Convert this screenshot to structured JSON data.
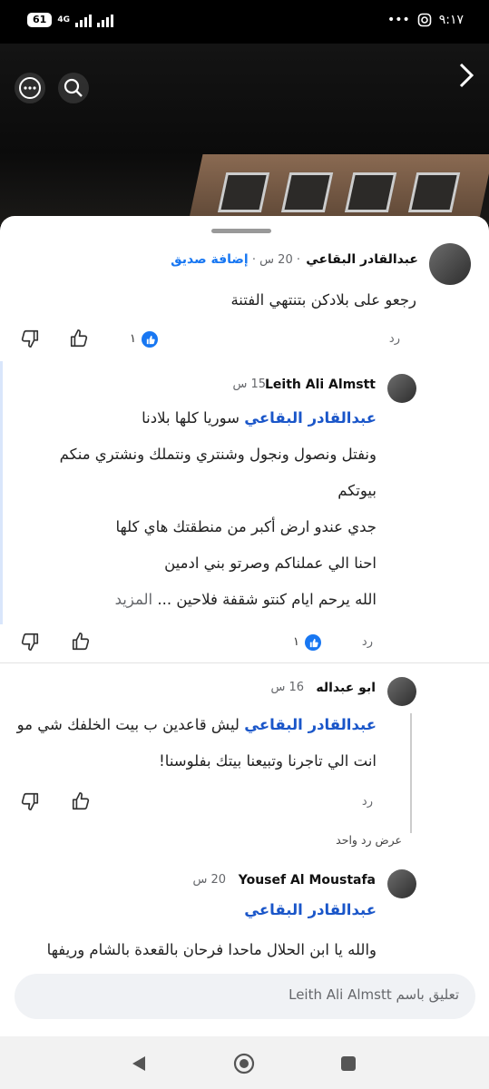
{
  "status": {
    "battery": "61",
    "network": "4G",
    "time": "٩:١٧"
  },
  "post_header": {
    "more_icon": "more-dots-icon",
    "search_icon": "search-icon",
    "next_icon": "chevron-right-icon"
  },
  "comments": [
    {
      "author": "عبدالقادر البقاعي",
      "time": "20 س",
      "separator": "·",
      "add_friend": "إضافة صديق",
      "lines": [
        "رجعو على بلادكن بتنتهي الفتنة"
      ],
      "reply_label": "رد",
      "like_count": "١"
    },
    {
      "author": "Leith Ali Almstt",
      "time": "15 س",
      "mention": "عبدالقادر البقاعي",
      "first_line_rest": "سوريا كلها بلادنا",
      "lines": [
        "ونفتل ونصول ونجول وشنتري ونتملك ونشتري منكم",
        "بيوتكم",
        "جدي عندو ارض أكبر من منطقتك هاي كلها",
        "احنا الي عملناكم وصرتو بني ادمين",
        "الله يرحم ايام كنتو شقفة فلاحين ..."
      ],
      "more_label": "المزيد",
      "reply_label": "رد",
      "like_count": "١"
    },
    {
      "author": "ابو عبداله",
      "time": "16 س",
      "mention": "عبدالقادر البقاعي",
      "first_line_rest": "ليش قاعدين ب بيت الخلفك شي مو",
      "lines": [
        "انت الي تاجرنا وتبيعنا بيتك بفلوسنا!"
      ],
      "reply_label": "رد",
      "view_reply": "عرض رد واحد"
    },
    {
      "author": "Yousef Al Moustafa",
      "time": "20 س",
      "mention": "عبدالقادر البقاعي",
      "lines": [
        "والله يا ابن الحلال ماحدا فرحان بالقعدة بالشام وريفها"
      ]
    }
  ],
  "composer": {
    "placeholder": "تعليق باسم Leith Ali Almstt"
  },
  "colors": {
    "accent": "#1877f2",
    "mention": "#1a56c9",
    "muted": "#65676b"
  }
}
